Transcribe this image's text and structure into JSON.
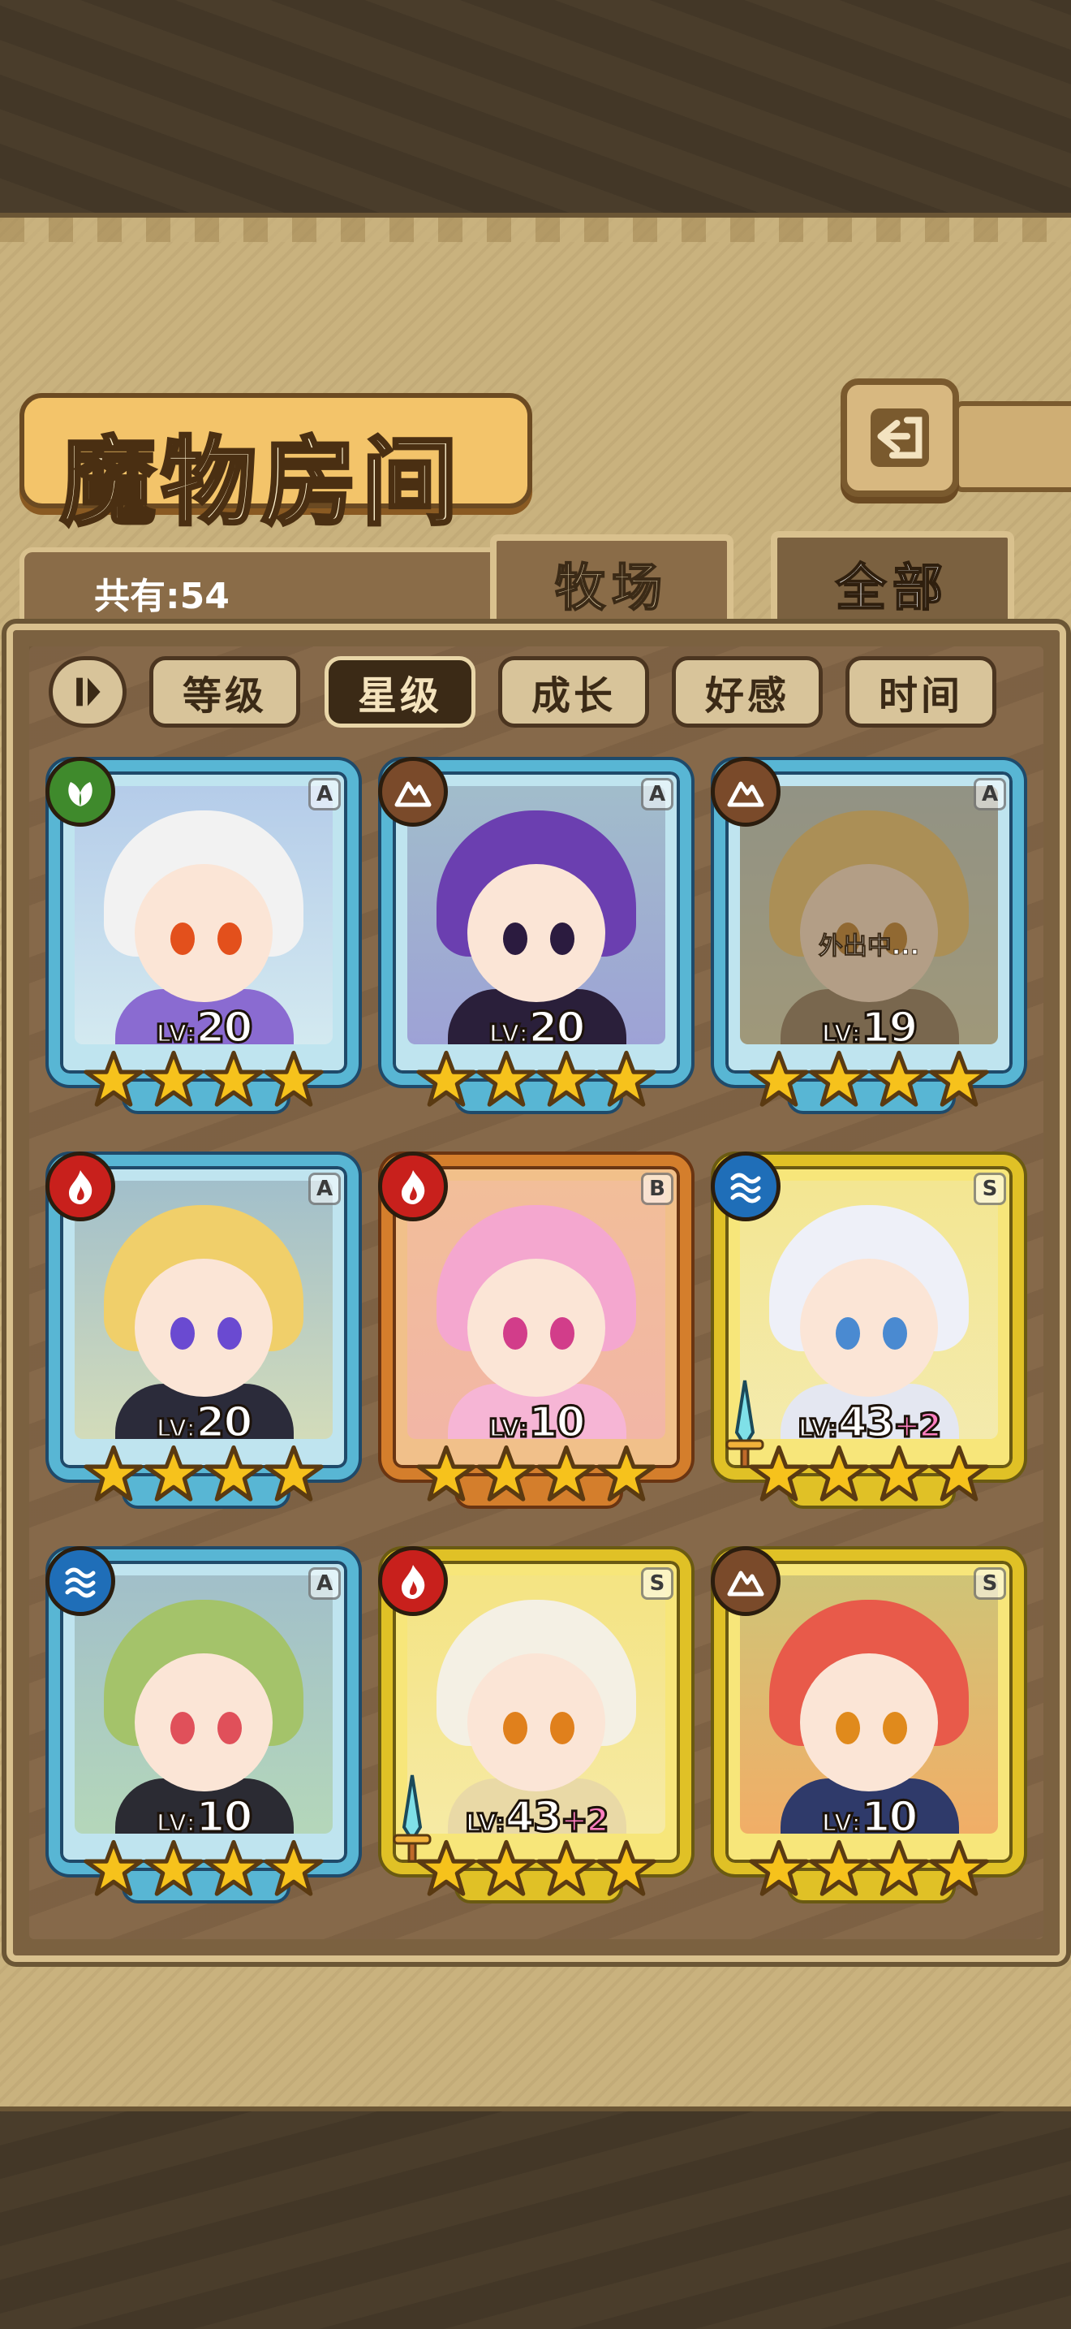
{
  "header": {
    "title": "魔物房间"
  },
  "count": {
    "label": "共有:54"
  },
  "tabs": [
    {
      "label": "牧场",
      "active": false
    },
    {
      "label": "全部",
      "active": true
    }
  ],
  "sort_chips": [
    {
      "label": "等级",
      "active": false
    },
    {
      "label": "星级",
      "active": true
    },
    {
      "label": "成长",
      "active": false
    },
    {
      "label": "好感",
      "active": false
    },
    {
      "label": "时间",
      "active": false
    }
  ],
  "monsters": [
    {
      "element": "grass",
      "rank": "A",
      "level": "20",
      "plus": "",
      "stars": 4,
      "weapon": false,
      "status": "",
      "hair": "#f2f2f2",
      "eye": "#e3501c",
      "outfit": "#8a6bd1"
    },
    {
      "element": "earth",
      "rank": "A",
      "level": "20",
      "plus": "",
      "stars": 4,
      "weapon": false,
      "status": "",
      "hair": "#6b3fb0",
      "eye": "#2b1b3f",
      "outfit": "#2a1f3a"
    },
    {
      "element": "earth",
      "rank": "A",
      "level": "19",
      "plus": "",
      "stars": 4,
      "weapon": false,
      "status": "外出中...",
      "hair": "#e8c46a",
      "eye": "#b0701c",
      "outfit": "#7a6a5a"
    },
    {
      "element": "fire",
      "rank": "A",
      "level": "20",
      "plus": "",
      "stars": 4,
      "weapon": false,
      "status": "",
      "hair": "#f0cf6a",
      "eye": "#6a4ad1",
      "outfit": "#2b2b3a"
    },
    {
      "element": "fire",
      "rank": "B",
      "level": "10",
      "plus": "",
      "stars": 4,
      "weapon": false,
      "status": "",
      "hair": "#f4a7cf",
      "eye": "#d23d8a",
      "outfit": "#f6b5d5"
    },
    {
      "element": "water",
      "rank": "S",
      "level": "43",
      "plus": "+2",
      "stars": 4,
      "weapon": true,
      "status": "",
      "hair": "#eef0f8",
      "eye": "#4a8ad1",
      "outfit": "#e4e7f1"
    },
    {
      "element": "water",
      "rank": "A",
      "level": "10",
      "plus": "",
      "stars": 4,
      "weapon": false,
      "status": "",
      "hair": "#a4c36a",
      "eye": "#e0505a",
      "outfit": "#2b2b33"
    },
    {
      "element": "fire",
      "rank": "S",
      "level": "43",
      "plus": "+2",
      "stars": 4,
      "weapon": true,
      "status": "",
      "hair": "#f4f0e4",
      "eye": "#e0801c",
      "outfit": "#e9d9a6"
    },
    {
      "element": "earth",
      "rank": "S",
      "level": "10",
      "plus": "",
      "stars": 4,
      "weapon": false,
      "status": "",
      "hair": "#e85a4a",
      "eye": "#e08a1c",
      "outfit": "#2f3a6a"
    }
  ],
  "colors": {
    "grass": "#3f8a2c",
    "earth": "#7a4a2a",
    "fire": "#c8201c",
    "water": "#1f6eb8",
    "star": "#f6c21c"
  }
}
